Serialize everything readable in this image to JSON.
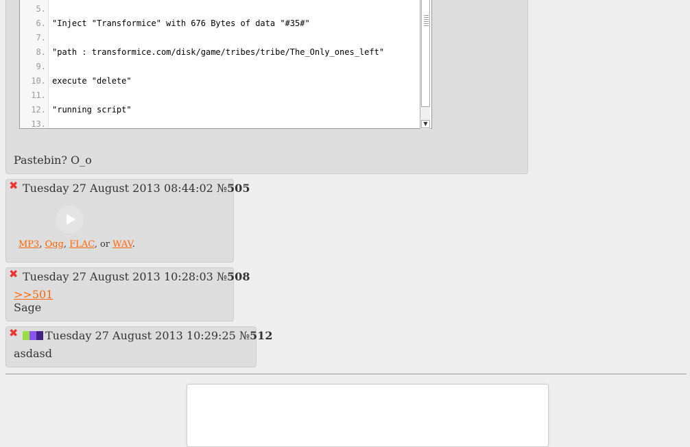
{
  "posts": {
    "first": {
      "code_lines": [
        {
          "no": "5.",
          "text": ""
        },
        {
          "no": "6.",
          "text": "\"Inject \"Transformice\" with 676 Bytes of data \"#35#\""
        },
        {
          "no": "7.",
          "text": ""
        },
        {
          "no": "8.",
          "text": "\"path : transformice.com/disk/game/tribes/tribe/The_Only_ones_left\""
        },
        {
          "no": "9.",
          "text": ""
        },
        {
          "no": "10.",
          "text": "execute \"delete\""
        },
        {
          "no": "11.",
          "text": ""
        },
        {
          "no": "12.",
          "text": "\"running script\""
        },
        {
          "no": "13.",
          "text": ""
        }
      ],
      "message": "Pastebin? O_o"
    },
    "p505": {
      "date": "Tuesday 27 August 2013 08:44:02",
      "num_prefix": "№ ",
      "num": "505",
      "formats": {
        "mp3": "MP3",
        "ogg": "Ogg",
        "flac": "FLAC",
        "wav": "WAV",
        "sep1": ", ",
        "sep2": ", ",
        "sep3": ", or ",
        "end": "."
      }
    },
    "p508": {
      "date": "Tuesday 27 August 2013 10:28:03",
      "num_prefix": "№ ",
      "num": "508",
      "reply_link": ">>501",
      "message": "Sage"
    },
    "p512": {
      "date": "Tuesday 27 August 2013 10:29:25",
      "num_prefix": "№ ",
      "num": "512",
      "flag_colors": [
        "#99dd44",
        "#8855ee",
        "#442288"
      ],
      "message": "asdasd"
    }
  },
  "icons": {
    "delete": "close-icon",
    "play": "play-icon",
    "flag": "flag-icon"
  },
  "colors": {
    "accent_link": "#ff6600",
    "delete": "#ee3333",
    "post_bg": "#dddddd"
  }
}
